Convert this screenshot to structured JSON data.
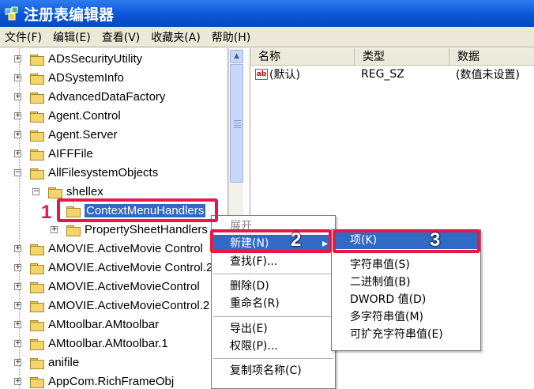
{
  "window": {
    "title": "注册表编辑器"
  },
  "menubar": [
    "文件(F)",
    "编辑(E)",
    "查看(V)",
    "收藏夹(A)",
    "帮助(H)"
  ],
  "tree": [
    {
      "label": "ADsSecurityUtility",
      "indent": 0,
      "exp": "+"
    },
    {
      "label": "ADSystemInfo",
      "indent": 0,
      "exp": "+"
    },
    {
      "label": "AdvancedDataFactory",
      "indent": 0,
      "exp": "+"
    },
    {
      "label": "Agent.Control",
      "indent": 0,
      "exp": "+"
    },
    {
      "label": "Agent.Server",
      "indent": 0,
      "exp": "+"
    },
    {
      "label": "AIFFFile",
      "indent": 0,
      "exp": "+"
    },
    {
      "label": "AllFilesystemObjects",
      "indent": 0,
      "exp": "-"
    },
    {
      "label": "shellex",
      "indent": 1,
      "exp": "-"
    },
    {
      "label": "ContextMenuHandlers",
      "indent": 2,
      "exp": "",
      "selected": true
    },
    {
      "label": "PropertySheetHandlers",
      "indent": 2,
      "exp": "+"
    },
    {
      "label": "AMOVIE.ActiveMovie Control",
      "indent": 0,
      "exp": "+"
    },
    {
      "label": "AMOVIE.ActiveMovie Control.2",
      "indent": 0,
      "exp": "+"
    },
    {
      "label": "AMOVIE.ActiveMovieControl",
      "indent": 0,
      "exp": "+"
    },
    {
      "label": "AMOVIE.ActiveMovieControl.2",
      "indent": 0,
      "exp": "+"
    },
    {
      "label": "AMtoolbar.AMtoolbar",
      "indent": 0,
      "exp": "+"
    },
    {
      "label": "AMtoolbar.AMtoolbar.1",
      "indent": 0,
      "exp": "+"
    },
    {
      "label": "anifile",
      "indent": 0,
      "exp": "+"
    },
    {
      "label": "AppCom.RichFrameObj",
      "indent": 0,
      "exp": "+"
    }
  ],
  "columns": {
    "name": "名称",
    "type": "类型",
    "data": "数据"
  },
  "values": [
    {
      "name": "(默认)",
      "type": "REG_SZ",
      "data": "(数值未设置)"
    }
  ],
  "context_menu": [
    {
      "label": "展开",
      "disabled": true
    },
    {
      "label": "新建(N)",
      "submenu": true,
      "highlighted": true
    },
    {
      "label": "查找(F)..."
    },
    {
      "sep": true
    },
    {
      "label": "删除(D)"
    },
    {
      "label": "重命名(R)"
    },
    {
      "sep": true
    },
    {
      "label": "导出(E)"
    },
    {
      "label": "权限(P)..."
    },
    {
      "sep": true
    },
    {
      "label": "复制项名称(C)"
    }
  ],
  "submenu": [
    {
      "label": "项(K)",
      "highlighted": true
    },
    {
      "sep": true
    },
    {
      "label": "字符串值(S)"
    },
    {
      "label": "二进制值(B)"
    },
    {
      "label": "DWORD 值(D)"
    },
    {
      "label": "多字符串值(M)"
    },
    {
      "label": "可扩充字符串值(E)"
    }
  ],
  "annotations": [
    "1",
    "2",
    "3"
  ],
  "colors": {
    "highlight": "#316ac5",
    "annotation": "#e8174a",
    "titlebar": "#0a55d6"
  },
  "icons": [
    "registry-app-icon",
    "folder-icon",
    "string-value-icon",
    "submenu-arrow-icon"
  ]
}
